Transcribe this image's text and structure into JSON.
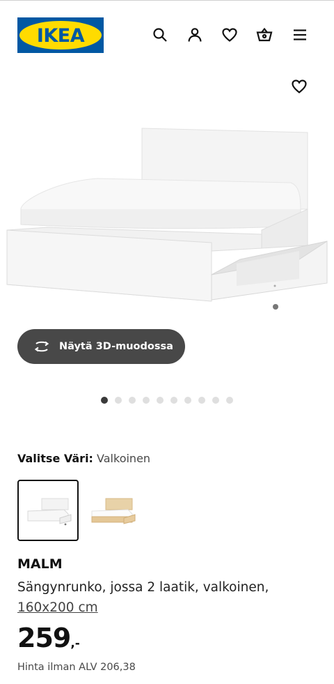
{
  "header": {
    "logo_text": "IKEA",
    "icons": [
      "search-icon",
      "user-icon",
      "heart-icon",
      "basket-icon",
      "menu-icon"
    ]
  },
  "image_nav": {
    "total": 10,
    "active": 0
  },
  "view3d": {
    "label": "Näytä 3D-muodossa",
    "icon": "rotate-3d-icon"
  },
  "color": {
    "label": "Valitse Väri:",
    "value": "Valkoinen",
    "options": [
      "white",
      "oak"
    ]
  },
  "product": {
    "name": "MALM",
    "description": "Sängynrunko, jossa 2 laatik, valkoinen,",
    "size": "160x200 cm",
    "price": "259",
    "price_suffix": ",-",
    "vat_text": "Hinta ilman ALV 206,38"
  },
  "colors": {
    "brand_blue": "#0058A3",
    "brand_yellow": "#FFDB00",
    "button_dark": "#484848"
  }
}
